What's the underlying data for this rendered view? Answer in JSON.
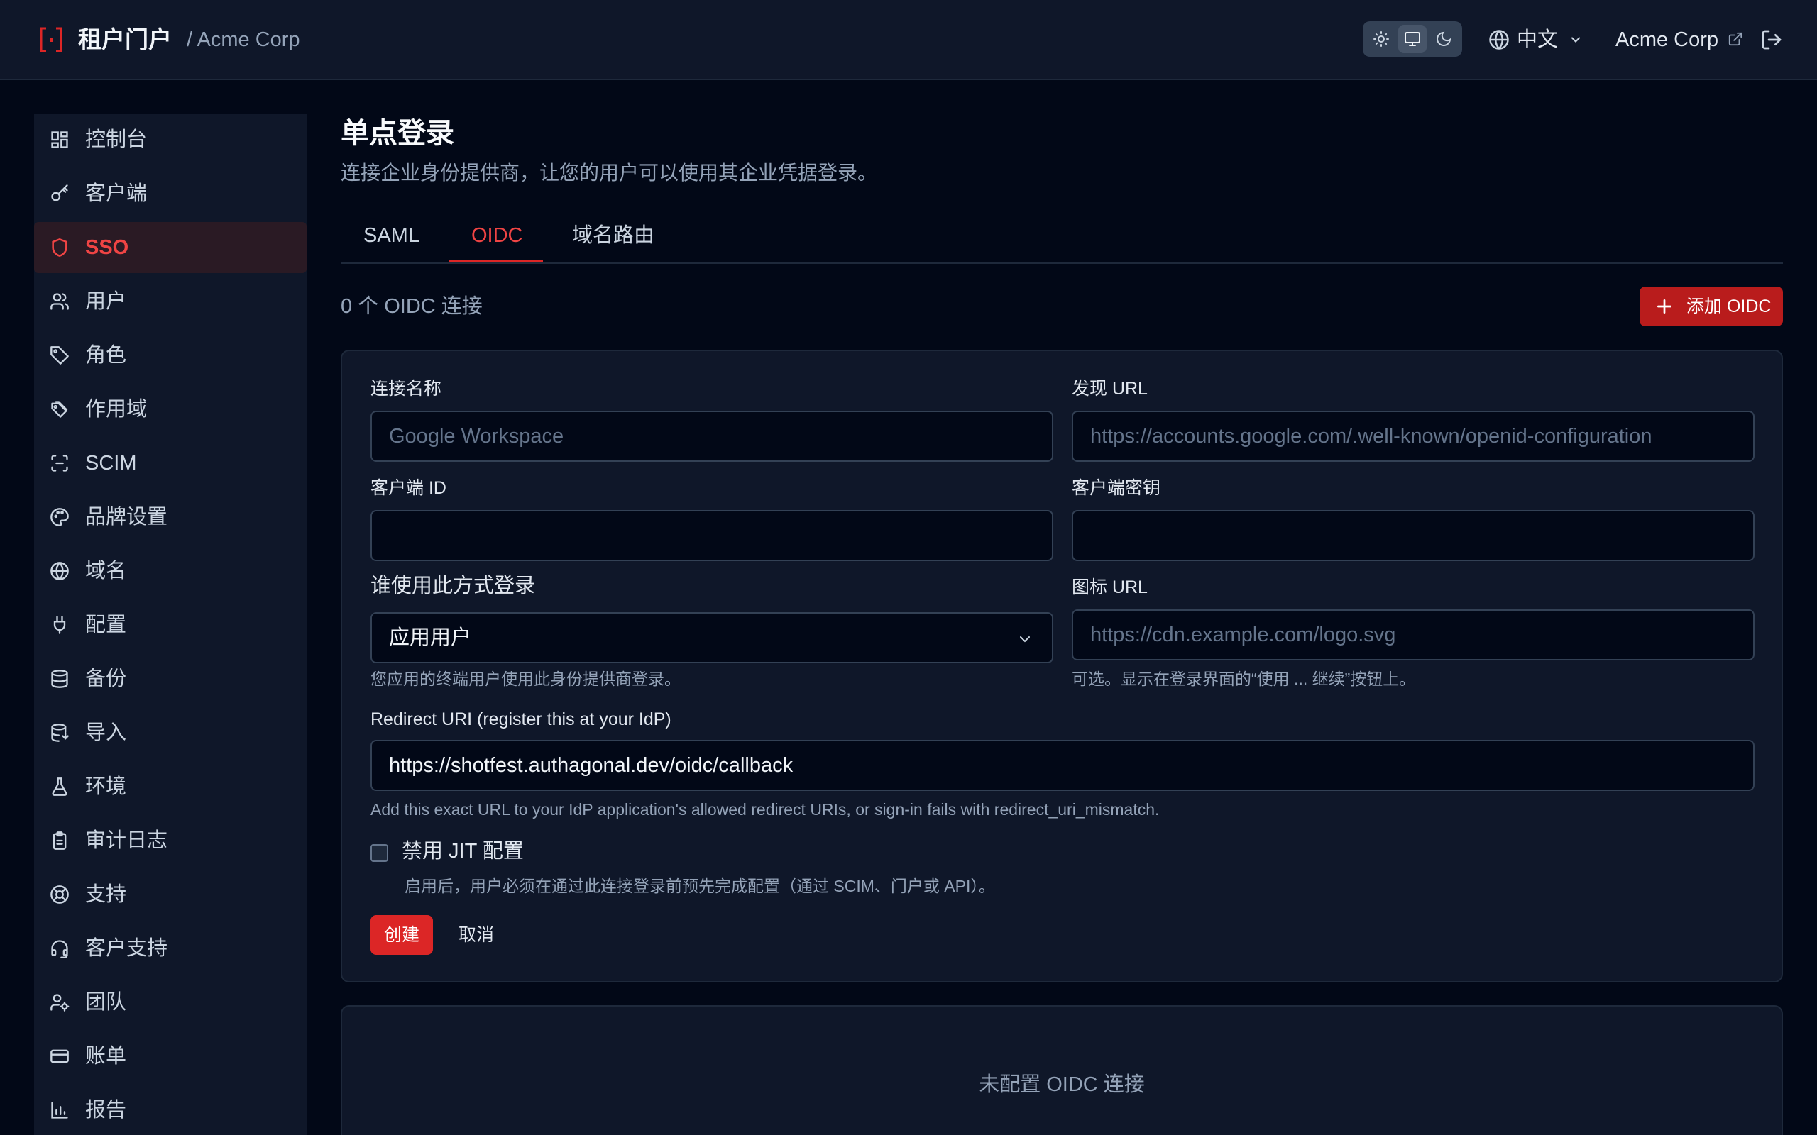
{
  "header": {
    "app_title": "租户门户",
    "breadcrumb": "/ Acme Corp",
    "language": "中文",
    "org_link": "Acme Corp",
    "icons": [
      "logo-icon",
      "sun-icon",
      "monitor-icon",
      "moon-icon",
      "globe-icon",
      "chevron-down-icon",
      "external-link-icon",
      "logout-icon"
    ],
    "theme_active": "system"
  },
  "sidebar": {
    "items": [
      {
        "label": "控制台",
        "icon": "dashboard-icon"
      },
      {
        "label": "客户端",
        "icon": "key-icon"
      },
      {
        "label": "SSO",
        "icon": "shield-icon",
        "active": true
      },
      {
        "label": "用户",
        "icon": "users-icon"
      },
      {
        "label": "角色",
        "icon": "tag-icon"
      },
      {
        "label": "作用域",
        "icon": "tags-icon"
      },
      {
        "label": "SCIM",
        "icon": "scan-icon"
      },
      {
        "label": "品牌设置",
        "icon": "palette-icon"
      },
      {
        "label": "域名",
        "icon": "globe-icon"
      },
      {
        "label": "配置",
        "icon": "plug-icon"
      },
      {
        "label": "备份",
        "icon": "database-icon"
      },
      {
        "label": "导入",
        "icon": "database-import-icon"
      },
      {
        "label": "环境",
        "icon": "flask-icon"
      },
      {
        "label": "审计日志",
        "icon": "clipboard-icon"
      },
      {
        "label": "支持",
        "icon": "lifebuoy-icon"
      },
      {
        "label": "客户支持",
        "icon": "headset-icon"
      },
      {
        "label": "团队",
        "icon": "user-cog-icon"
      },
      {
        "label": "账单",
        "icon": "credit-card-icon"
      },
      {
        "label": "报告",
        "icon": "bar-chart-icon"
      }
    ]
  },
  "main": {
    "title": "单点登录",
    "subtitle": "连接企业身份提供商，让您的用户可以使用其企业凭据登录。",
    "tabs": [
      {
        "label": "SAML"
      },
      {
        "label": "OIDC",
        "active": true
      },
      {
        "label": "域名路由"
      }
    ],
    "count_text": "0 个 OIDC 连接",
    "add_button": "添加 OIDC",
    "form": {
      "name_label": "连接名称",
      "name_placeholder": "Google Workspace",
      "discovery_label": "发现 URL",
      "discovery_placeholder": "https://accounts.google.com/.well-known/openid-configuration",
      "client_id_label": "客户端 ID",
      "client_id_value": "",
      "client_secret_label": "客户端密钥",
      "client_secret_value": "",
      "audience_label": "谁使用此方式登录",
      "audience_value": "应用用户",
      "audience_hint": "您应用的终端用户使用此身份提供商登录。",
      "icon_url_label": "图标 URL",
      "icon_url_placeholder": "https://cdn.example.com/logo.svg",
      "icon_url_hint": "可选。显示在登录界面的“使用 ... 继续”按钮上。",
      "redirect_label": "Redirect URI (register this at your IdP)",
      "redirect_value": "https://shotfest.authagonal.dev/oidc/callback",
      "redirect_hint": "Add this exact URL to your IdP application's allowed redirect URIs, or sign-in fails with redirect_uri_mismatch.",
      "jit_label": "禁用 JIT 配置",
      "jit_checked": false,
      "jit_hint": "启用后，用户必须在通过此连接登录前预先完成配置（通过 SCIM、门户或 API）。",
      "create_button": "创建",
      "cancel_button": "取消"
    },
    "empty_text": "未配置 OIDC 连接"
  },
  "colors": {
    "accent": "#dc2626",
    "background": "#020817",
    "panel": "#0f1729",
    "border": "#1e293b"
  }
}
